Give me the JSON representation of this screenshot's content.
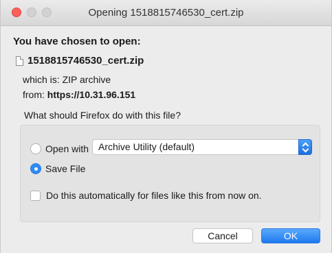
{
  "window": {
    "title": "Opening 1518815746530_cert.zip"
  },
  "dialog": {
    "heading": "You have chosen to open:",
    "file_name": "1518815746530_cert.zip",
    "which_label": "which is: ",
    "which_value": "ZIP archive",
    "from_label": "from: ",
    "from_value": "https://10.31.96.151",
    "question": "What should Firefox do with this file?",
    "open_with_label": "Open with",
    "open_with_app": "Archive Utility (default)",
    "save_file_label": "Save File",
    "auto_label": "Do this automatically for files like this from now on.",
    "selected_option": "Save File"
  },
  "buttons": {
    "cancel": "Cancel",
    "ok": "OK"
  },
  "colors": {
    "accent": "#2f8bf5",
    "close": "#fc605c"
  }
}
